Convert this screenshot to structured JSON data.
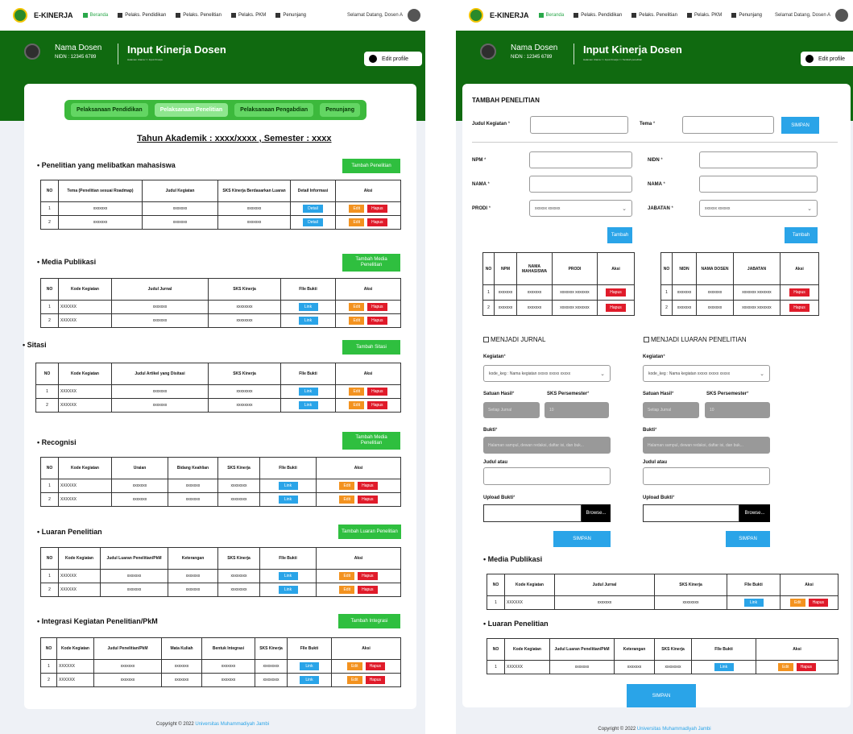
{
  "nav": {
    "brand": "E-KINERJA",
    "links": [
      "Beranda",
      "Pelaks. Pendidikan",
      "Pelaks. Penelitian",
      "Pelaks. PKM",
      "Penunjang"
    ],
    "welcome": "Selamat Datang, Dosen A"
  },
  "profile": {
    "name": "Nama Dosen",
    "nidn": "NIDN : 12345 6789",
    "title": "Input Kinerja Dosen",
    "crumb_left": "Halaman Utama >> Input Kinerja",
    "crumb_right": "Halaman Utama >> Input Kinerja >> Tambah penelitian",
    "edit_profile": "Edit profile"
  },
  "tabs": [
    "Pelaksanaan Pendidikan",
    "Pelaksanaan Penelitian",
    "Pelaksanaan Pengabdian",
    "Penunjang"
  ],
  "tahun_akademik": "Tahun Akademik : xxxx/xxxx , Semester : xxxx",
  "buttons": {
    "detail": "Detail",
    "edit": "Edit",
    "hapus": "Hapus",
    "link": "Link",
    "tambah": "Tambah",
    "simpan": "SIMPAN",
    "browse": "Browse..."
  },
  "sections": {
    "penelitian": {
      "title": "Penelitian yang melibatkan mahasiswa",
      "button": "Tambah Penelitian",
      "headers": [
        "NO",
        "Tema (Penelitian sesuai Roadmap)",
        "Judul Kegiatan",
        "SKS Kinerja Berdasarkan Luaran",
        "Detail Informasi",
        "Aksi"
      ],
      "rows": [
        [
          "1",
          "xxxxxxx",
          "xxxxxxx",
          "xxxxxxx"
        ],
        [
          "2",
          "xxxxxxx",
          "xxxxxxx",
          "xxxxxxx"
        ]
      ]
    },
    "media": {
      "title": "Media Publikasi",
      "button": "Tambah Media Penelitian",
      "headers": [
        "NO",
        "Kode Kegiatan",
        "Judul Jurnal",
        "SKS Kinerja",
        "FIle Bukti",
        "Aksi"
      ],
      "rows": [
        [
          "1",
          "XXXXXX",
          "xxxxxxx",
          "xxxxxxxx"
        ],
        [
          "2",
          "XXXXXX",
          "xxxxxxx",
          "xxxxxxxx"
        ]
      ]
    },
    "sitasi": {
      "title": "Sitasi",
      "button": "Tambah Sitasi",
      "headers": [
        "NO",
        "Kode Kegiatan",
        "Judul Artikel yang Disitasi",
        "SKS Kinerja",
        "FIle Bukti",
        "Aksi"
      ],
      "rows": [
        [
          "1",
          "XXXXXX",
          "xxxxxxx",
          "xxxxxxxx"
        ],
        [
          "2",
          "XXXXXX",
          "xxxxxxx",
          "xxxxxxxx"
        ]
      ]
    },
    "recognisi": {
      "title": "Recognisi",
      "button": "Tambah Media Penelitian",
      "headers": [
        "NO",
        "Kode Kegiatan",
        "Uraian",
        "Bidang Keahlian",
        "SKS Kinerja",
        "FIle Bukti",
        "Aksi"
      ],
      "rows": [
        [
          "1",
          "XXXXXX",
          "xxxxxxx",
          "xxxxxxx",
          "xxxxxxxx"
        ],
        [
          "2",
          "XXXXXX",
          "xxxxxxx",
          "xxxxxxx",
          "xxxxxxxx"
        ]
      ]
    },
    "luaran": {
      "title": "Luaran Penelitian",
      "button": "Tambah Luaran Penelitian",
      "headers": [
        "NO",
        "Kode Kegiatan",
        "Judul Luaran Penelitian/PkM",
        "Keterangan",
        "SKS Kinerja",
        "FIle Bukti",
        "Aksi"
      ],
      "rows": [
        [
          "1",
          "XXXXXX",
          "xxxxxxx",
          "xxxxxxx",
          "xxxxxxxx"
        ],
        [
          "2",
          "XXXXXX",
          "xxxxxxx",
          "xxxxxxx",
          "xxxxxxxx"
        ]
      ]
    },
    "integrasi": {
      "title": "Integrasi Kegiatan Penelitian/PkM",
      "button": "Tambah Integrasi",
      "headers": [
        "NO",
        "Kode Kegiatan",
        "Judul Penelitian/PkM",
        "Mata Kuliah",
        "Bentuk Integrasi",
        "SKS Kinerja",
        "FIle Bukti",
        "Aksi"
      ],
      "rows": [
        [
          "1",
          "XXXXXX",
          "xxxxxxx",
          "xxxxxxx",
          "xxxxxxx",
          "xxxxxxxx"
        ],
        [
          "2",
          "XXXXXX",
          "xxxxxxx",
          "xxxxxxx",
          "xxxxxxx",
          "xxxxxxxx"
        ]
      ]
    }
  },
  "form": {
    "title": "TAMBAH PENELITIAN",
    "judul_kegiatan": "Judul Kegiatan",
    "tema": "Tema",
    "npm": "NPM",
    "nama": "NAMA",
    "prodi": "PRODI",
    "nidn": "NIDN",
    "jabatan": "JABATAN",
    "prodi_value": "xxxxxx xxxxxx",
    "jabatan_value": "xxxxxx xxxxxx",
    "mhs_headers": [
      "NO",
      "NPM",
      "NAMA MAHASISWA",
      "PRODI",
      "Aksi"
    ],
    "mhs_rows": [
      [
        "1",
        "xxxxxxx",
        "xxxxxxx",
        "xxxxxxx xxxxxxx"
      ],
      [
        "2",
        "xxxxxxx",
        "xxxxxxx",
        "xxxxxxx xxxxxxx"
      ]
    ],
    "dosen_headers": [
      "NO",
      "NIDN",
      "NAMA DOSEN",
      "JABATAN",
      "Aksi"
    ],
    "dosen_rows": [
      [
        "1",
        "xxxxxxx",
        "xxxxxxx",
        "xxxxxxx xxxxxxx"
      ],
      [
        "2",
        "xxxxxxx",
        "xxxxxxx",
        "xxxxxxx xxxxxxx"
      ]
    ],
    "jurnal_check": "MENJADI JURNAL",
    "luaran_check": "MENJADI LUARAN PENELITIAN",
    "kegiatan": "Kegiatan",
    "kegiatan_value": "kode_keg : Nama kegiatan xxxxx xxxxx xxxxx",
    "satuan_hasil": "Satuan Hasil",
    "sks_persemester": "SKS Persemester",
    "satuan_value": "Setiap Jurnal",
    "sks_value": "10",
    "bukti": "Bukti",
    "bukti_value": "Halaman sampul, dewan redaksi, daftar isi, dan buk...",
    "judul_atau": "Judul atau",
    "upload_bukti": "Upload Bukti",
    "media_title": "Media Publikasi",
    "media_headers": [
      "NO",
      "Kode Kegiatan",
      "Judul Jurnal",
      "SKS Kinerja",
      "FIle Bukti",
      "Aksi"
    ],
    "media_rows": [
      [
        "1",
        "XXXXXX",
        "xxxxxxx",
        "xxxxxxxx"
      ]
    ],
    "luaran_title": "Luaran Penelitian",
    "luaran_headers": [
      "NO",
      "Kode Kegiatan",
      "Judul Luaran Penelitian/PkM",
      "Keterangan",
      "SKS Kinerja",
      "FIle Bukti",
      "Aksi"
    ],
    "luaran_rows": [
      [
        "1",
        "XXXXXX",
        "xxxxxxx",
        "xxxxxxx",
        "xxxxxxxx"
      ]
    ]
  },
  "footer": {
    "text": "Copyright © 2022 ",
    "link": "Universitas Muhammadiyah Jambi"
  },
  "colors": {
    "header_green": "#106a10",
    "tab_bar": "#3cb93c",
    "add_button": "#2fbf3f",
    "link_blue": "#2aa4e8",
    "edit_orange": "#f3921f",
    "delete_red": "#e01b2a"
  }
}
